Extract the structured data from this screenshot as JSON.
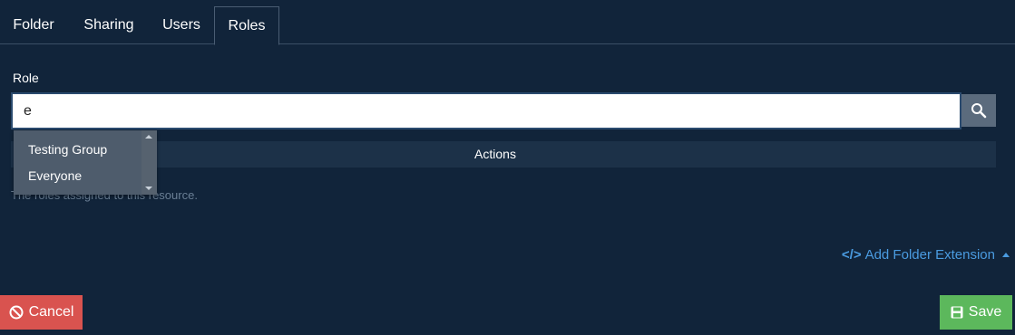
{
  "tabs": [
    {
      "label": "Folder"
    },
    {
      "label": "Sharing"
    },
    {
      "label": "Users"
    },
    {
      "label": "Roles",
      "active": true
    }
  ],
  "role_field": {
    "label": "Role",
    "value": "e"
  },
  "autocomplete": {
    "options": [
      "Testing Group",
      "Everyone"
    ]
  },
  "table": {
    "actions_header": "Actions",
    "empty_text": "The roles assigned to this resource."
  },
  "extension_link": {
    "icon": "</>",
    "label": "Add Folder Extension"
  },
  "buttons": {
    "cancel": "Cancel",
    "save": "Save"
  },
  "colors": {
    "background": "#11243a",
    "cancel": "#d9534f",
    "save": "#5cb85c",
    "link": "#4a9be0"
  }
}
